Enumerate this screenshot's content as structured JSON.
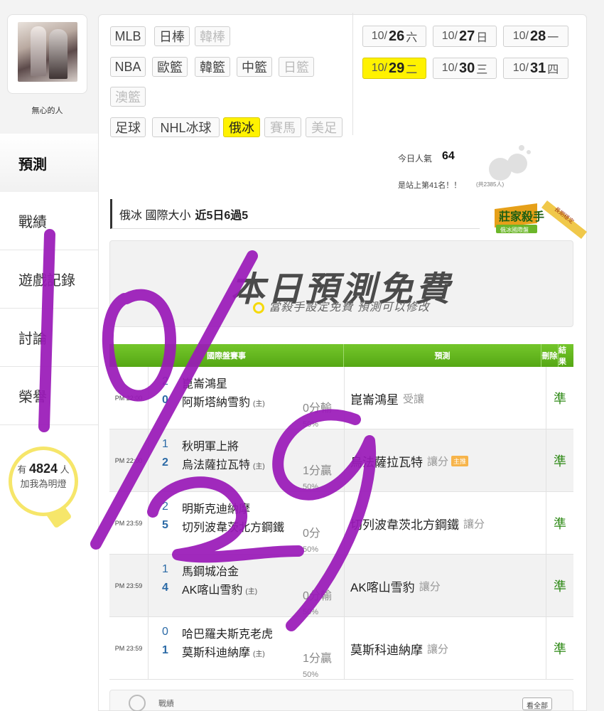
{
  "user": {
    "name": "無心的人"
  },
  "sidebar": {
    "items": [
      {
        "label": "預測",
        "active": true
      },
      {
        "label": "戰績"
      },
      {
        "label": "遊戲記錄"
      },
      {
        "label": "討論"
      },
      {
        "label": "榮譽"
      }
    ],
    "lamp": {
      "prefix": "有",
      "count": "4824",
      "unit": "人",
      "caption": "加我為明燈"
    }
  },
  "sports": {
    "row1": [
      {
        "label": "MLB",
        "state": "normal"
      },
      {
        "label": "日棒",
        "state": "normal"
      },
      {
        "label": "韓棒",
        "state": "off"
      }
    ],
    "row2": [
      {
        "label": "NBA",
        "state": "normal"
      },
      {
        "label": "歐籃",
        "state": "normal"
      },
      {
        "label": "韓籃",
        "state": "normal"
      },
      {
        "label": "中籃",
        "state": "normal"
      },
      {
        "label": "日籃",
        "state": "off"
      }
    ],
    "row3": [
      {
        "label": "澳籃",
        "state": "off"
      }
    ],
    "row4": [
      {
        "label": "足球",
        "state": "normal"
      },
      {
        "label": "NHL冰球",
        "state": "normal"
      },
      {
        "label": "俄冰",
        "state": "on"
      },
      {
        "label": "賽馬",
        "state": "off"
      },
      {
        "label": "美足",
        "state": "off"
      }
    ]
  },
  "dates": [
    {
      "prefix": "10/",
      "day": "26",
      "weekday": "六",
      "active": false
    },
    {
      "prefix": "10/",
      "day": "27",
      "weekday": "日",
      "active": false
    },
    {
      "prefix": "10/",
      "day": "28",
      "weekday": "一",
      "active": false
    },
    {
      "prefix": "10/",
      "day": "29",
      "weekday": "二",
      "active": true
    },
    {
      "prefix": "10/",
      "day": "30",
      "weekday": "三",
      "active": false
    },
    {
      "prefix": "10/",
      "day": "31",
      "weekday": "四",
      "active": false
    }
  ],
  "popularity": {
    "label": "今日人氣",
    "value": "64",
    "rank": "是站上第41名！！",
    "rank_sub": "(共2385人)"
  },
  "section": {
    "league": "俄冰 國際大小",
    "highlight": "近5日6過5"
  },
  "badge": {
    "title": "莊家殺手",
    "sub": "俄冰國際盤",
    "ribbon": "長期穩定"
  },
  "banner": {
    "title": "本日預測免費",
    "subtitle": "當殺手設定免費 預測可以修改"
  },
  "table": {
    "headers": {
      "game": "國際盤賽事",
      "pick": "預測",
      "delete": "刪除",
      "result": "結果"
    },
    "rows": [
      {
        "time": "PM 22:00",
        "score_away": "2",
        "team_away": "崑崙鴻星",
        "score_home": "0",
        "team_home": "阿斯塔納雪豹",
        "home_tag": "(主)",
        "handicap": "0分輸",
        "pct": "50%",
        "pick_team": "崑崙鴻星",
        "pick_kind": "受讓",
        "main": false,
        "result": "準"
      },
      {
        "time": "PM 22:00",
        "score_away": "1",
        "team_away": "秋明軍上將",
        "score_home": "2",
        "team_home": "烏法薩拉瓦特",
        "home_tag": "(主)",
        "handicap": "1分贏",
        "pct": "50%",
        "pick_team": "烏法薩拉瓦特",
        "pick_kind": "讓分",
        "main": true,
        "main_label": "主推",
        "result": "準"
      },
      {
        "time": "PM 23:59",
        "score_away": "2",
        "team_away": "明斯克迪納摩",
        "score_home": "5",
        "team_home": "切列波韋茨北方鋼鐵",
        "home_tag": "",
        "handicap": "0分",
        "pct": "50%",
        "pick_team": "切列波韋茨北方鋼鐵",
        "pick_kind": "讓分",
        "main": false,
        "result": "準"
      },
      {
        "time": "PM 23:59",
        "score_away": "1",
        "team_away": "馬鋼城冶金",
        "score_home": "4",
        "team_home": "AK喀山雪豹",
        "home_tag": "(主)",
        "handicap": "0分輸",
        "pct": "50%",
        "pick_team": "AK喀山雪豹",
        "pick_kind": "讓分",
        "main": false,
        "result": "準"
      },
      {
        "time": "PM 23:59",
        "score_away": "0",
        "team_away": "哈巴羅夫斯克老虎",
        "score_home": "1",
        "team_home": "莫斯科迪納摩",
        "home_tag": "(主)",
        "handicap": "1分贏",
        "pct": "50%",
        "pick_team": "莫斯科迪納摩",
        "pick_kind": "讓分",
        "main": false,
        "result": "準"
      }
    ]
  },
  "footer": {
    "label": "戰績",
    "more": "看全部"
  },
  "colors": {
    "accent_yellow": "#fff200",
    "header_green": "#5aac18",
    "result_green": "#2f8a17",
    "score_blue": "#2b6aa6",
    "scribble_purple": "#9a19b8"
  },
  "annotation": {
    "text": "10/29"
  }
}
